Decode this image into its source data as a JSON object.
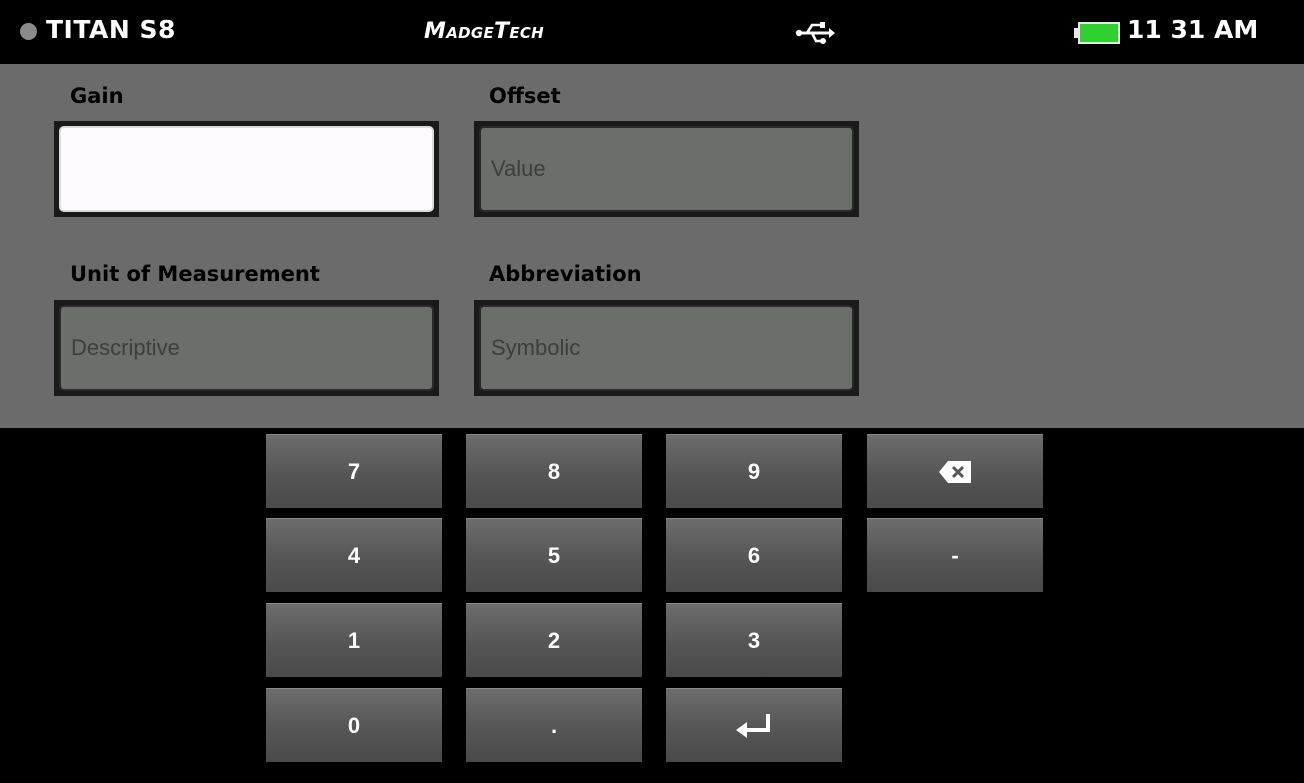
{
  "status_bar": {
    "device_name": "TITAN S8",
    "brand": "MadgeTech",
    "usb_icon": "usb-icon",
    "battery_icon": "battery-icon",
    "battery_color": "#2fd12f",
    "time": "11 31 AM"
  },
  "form": {
    "gain": {
      "label": "Gain",
      "value": "",
      "placeholder": ""
    },
    "offset": {
      "label": "Offset",
      "value": "",
      "placeholder": "Value"
    },
    "unit": {
      "label": "Unit of Measurement",
      "value": "",
      "placeholder": "Descriptive"
    },
    "abbreviation": {
      "label": "Abbreviation",
      "value": "",
      "placeholder": "Symbolic"
    }
  },
  "keypad": {
    "k7": "7",
    "k8": "8",
    "k9": "9",
    "k4": "4",
    "k5": "5",
    "k6": "6",
    "k1": "1",
    "k2": "2",
    "k3": "3",
    "k0": "0",
    "kdot": ".",
    "kminus": "-",
    "backspace_icon": "backspace-icon",
    "enter_icon": "enter-icon"
  },
  "colors": {
    "panel": "#6c6b6c",
    "field": "#6a6f69",
    "field_active": "#fdfbff",
    "background": "#000000"
  }
}
